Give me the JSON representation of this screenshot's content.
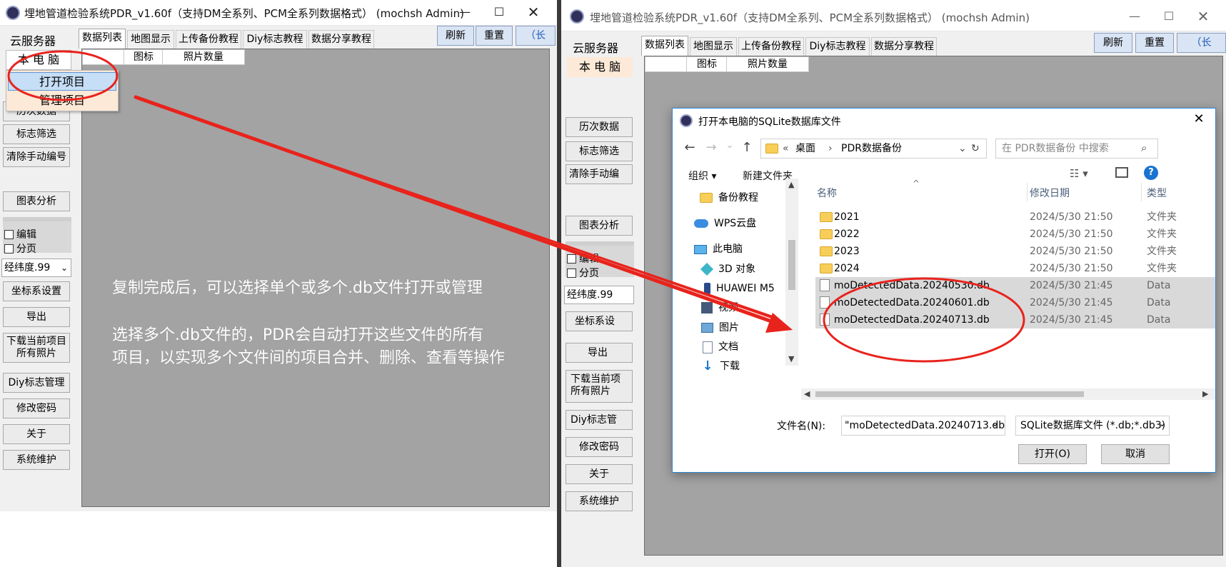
{
  "app": {
    "title": "埋地管道检验系统PDR_v1.60f（支持DM全系列、PCM全系列数据格式）  (mochsh Admin)",
    "window_controls": {
      "minimize": "—",
      "maximize": "☐",
      "close": "✕"
    },
    "top_buttons": {
      "refresh": "刷新",
      "reset": "重置",
      "partial": "（长"
    },
    "tabs": [
      "数据列表",
      "地图显示",
      "上传备份教程",
      "Diy标志教程",
      "数据分享教程"
    ],
    "list_columns": [
      "图标",
      "照片数量"
    ],
    "sidebar": {
      "cloud_server": "云服务器",
      "local_pc": "本 电 脑",
      "history": "历次数据",
      "mark_filter": "标志筛选",
      "clear_manual": "清除手动编号",
      "chart_analysis": "图表分析",
      "edit_label": "编辑",
      "paging_label": "分页",
      "coord_combo": "经纬度.99",
      "coord_system": "坐标系设置",
      "export": "导出",
      "download_photos": "下载当前项目\n所有照片",
      "diy_marks": "Diy标志管理",
      "change_password": "修改密码",
      "about": "关于",
      "maintenance": "系统维护"
    },
    "context_menu": [
      "打开项目",
      "管理项目"
    ],
    "overlay": {
      "line1": "复制完成后，可以选择单个或多个.db文件打开或管理",
      "line2": "选择多个.db文件的，PDR会自动打开这些文件的所有",
      "line3": "项目，以实现多个文件间的项目合并、删除、查看等操作"
    }
  },
  "right_sidebar_partial": {
    "history": "历次数据",
    "mark_filter": "标志筛选",
    "clear_manual": "清除手动编",
    "chart_analysis": "图表分析",
    "coord_combo": "经纬度.99",
    "coord_system": "坐标系设",
    "download_photos": "下载当前项\n所有照片",
    "diy_marks": "Diy标志管",
    "change_password": "修改密码"
  },
  "dialog": {
    "title": "打开本电脑的SQLite数据库文件",
    "close": "✕",
    "address": {
      "prefix": "«",
      "crumb1": "桌面",
      "separator": "›",
      "crumb2": "PDR数据备份"
    },
    "search_placeholder": "在 PDR数据备份 中搜索",
    "toolbar": {
      "organize": "组织 ▾",
      "new_folder": "新建文件夹"
    },
    "tree": [
      "备份教程",
      "WPS云盘",
      "此电脑",
      "3D 对象",
      "HUAWEI M5",
      "视频",
      "图片",
      "文档",
      "下载"
    ],
    "columns": {
      "name": "名称",
      "modified": "修改日期",
      "type": "类型"
    },
    "files": [
      {
        "name": "2021",
        "date": "2024/5/30 21:50",
        "type": "文件夹",
        "kind": "folder",
        "selected": false
      },
      {
        "name": "2022",
        "date": "2024/5/30 21:50",
        "type": "文件夹",
        "kind": "folder",
        "selected": false
      },
      {
        "name": "2023",
        "date": "2024/5/30 21:50",
        "type": "文件夹",
        "kind": "folder",
        "selected": false
      },
      {
        "name": "2024",
        "date": "2024/5/30 21:50",
        "type": "文件夹",
        "kind": "folder",
        "selected": false
      },
      {
        "name": "moDetectedData.20240530.db",
        "date": "2024/5/30 21:45",
        "type": "Data",
        "kind": "db",
        "selected": true
      },
      {
        "name": "moDetectedData.20240601.db",
        "date": "2024/5/30 21:45",
        "type": "Data",
        "kind": "db",
        "selected": true
      },
      {
        "name": "moDetectedData.20240713.db",
        "date": "2024/5/30 21:45",
        "type": "Data",
        "kind": "db",
        "selected": true
      }
    ],
    "filename_label": "文件名(N):",
    "filename_value": "\"moDetectedData.20240713.db\"",
    "filter_value": "SQLite数据库文件 (*.db;*.db3)",
    "open_button": "打开(O)",
    "cancel_button": "取消"
  },
  "colors": {
    "annotation_red": "#e8231c",
    "dialog_border": "#2e86d8",
    "grey_area": "#a3a3a3"
  }
}
